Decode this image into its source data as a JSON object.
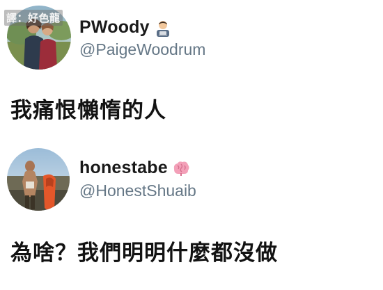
{
  "watermark": {
    "text": "譯：好色龍"
  },
  "tweets": [
    {
      "display_name": "PWoody",
      "name_emoji": "technologist-emoji",
      "handle": "@PaigeWoodrum",
      "text": "我痛恨懶惰的人",
      "avatar": "profile-photo-couple"
    },
    {
      "display_name": "honestabe",
      "name_emoji": "brain-emoji",
      "handle": "@HonestShuaib",
      "text": "為啥？我們明明什麼都沒做",
      "avatar": "profile-photo-kayak"
    }
  ],
  "colors": {
    "text": "#121212",
    "handle": "#657786",
    "background": "#ffffff"
  }
}
